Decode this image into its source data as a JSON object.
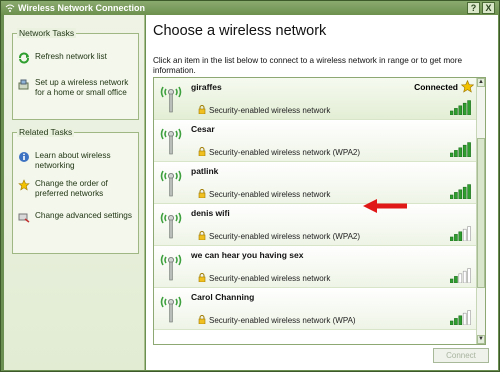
{
  "window": {
    "title": "Wireless Network Connection"
  },
  "title_buttons": {
    "help": "?",
    "close": "X"
  },
  "network_tasks": {
    "title": "Network Tasks",
    "items": [
      {
        "label": "Refresh network list",
        "icon": "refresh-icon"
      },
      {
        "label": "Set up a wireless network for a home or small office",
        "icon": "setup-icon"
      }
    ]
  },
  "related_tasks": {
    "title": "Related Tasks",
    "items": [
      {
        "label": "Learn about wireless networking",
        "icon": "info-icon"
      },
      {
        "label": "Change the order of preferred networks",
        "icon": "star-icon"
      },
      {
        "label": "Change advanced settings",
        "icon": "settings-icon"
      }
    ]
  },
  "main": {
    "heading": "Choose a wireless network",
    "intro": "Click an item in the list below to connect to a wireless network in range or to get more information."
  },
  "networks": [
    {
      "name": "giraffes",
      "security": "Security-enabled wireless network",
      "status": "Connected",
      "signal_bars": 5
    },
    {
      "name": "Cesar",
      "security": "Security-enabled wireless network (WPA2)",
      "status": "",
      "signal_bars": 5
    },
    {
      "name": "patlink",
      "security": "Security-enabled wireless network",
      "status": "",
      "signal_bars": 5
    },
    {
      "name": "denis wifi",
      "security": "Security-enabled wireless network (WPA2)",
      "status": "",
      "signal_bars": 3
    },
    {
      "name": "we can hear you having sex",
      "security": "Security-enabled wireless network",
      "status": "",
      "signal_bars": 2
    },
    {
      "name": "Carol Channing",
      "security": "Security-enabled wireless network (WPA)",
      "status": "",
      "signal_bars": 3
    }
  ],
  "connect_button": "Connect",
  "colors": {
    "frame": "#6b8f52",
    "accent": "#2e9e2e",
    "arrow": "#e01818",
    "star": "#f2c200"
  }
}
